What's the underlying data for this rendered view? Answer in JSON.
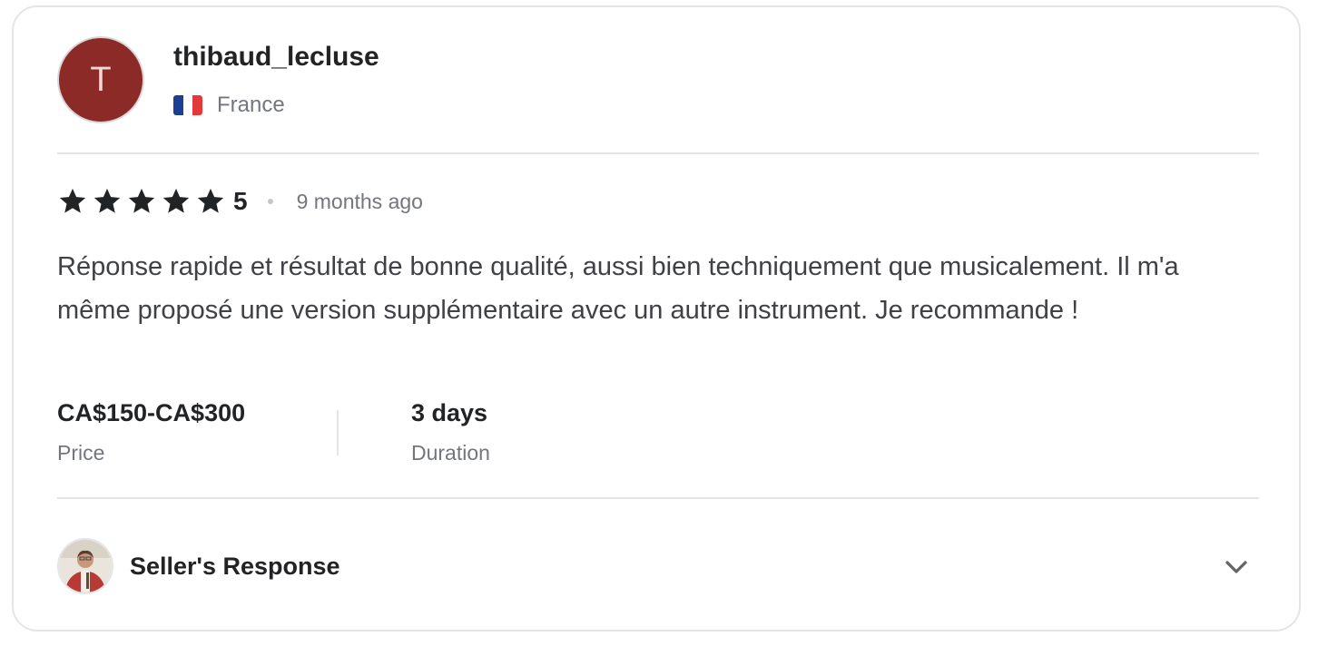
{
  "reviewer": {
    "initial": "T",
    "username": "thibaud_lecluse",
    "country": "France",
    "flag_icon": "france-flag-icon",
    "avatar_color": "#8b2a26"
  },
  "rating": {
    "stars": 5,
    "value": "5",
    "time_ago": "9 months ago",
    "star_icon": "star-icon"
  },
  "review": {
    "text": "Réponse rapide et résultat de bonne qualité, aussi bien techniquement que musicalement. Il m'a même proposé une version supplémentaire avec un autre instrument. Je recommande !"
  },
  "meta": {
    "price_value": "CA$150-CA$300",
    "price_label": "Price",
    "duration_value": "3 days",
    "duration_label": "Duration"
  },
  "seller_response": {
    "title": "Seller's Response",
    "expand_icon": "chevron-down-icon"
  },
  "colors": {
    "text_primary": "#222325",
    "text_secondary": "#74767e",
    "border": "#e4e5e7"
  }
}
